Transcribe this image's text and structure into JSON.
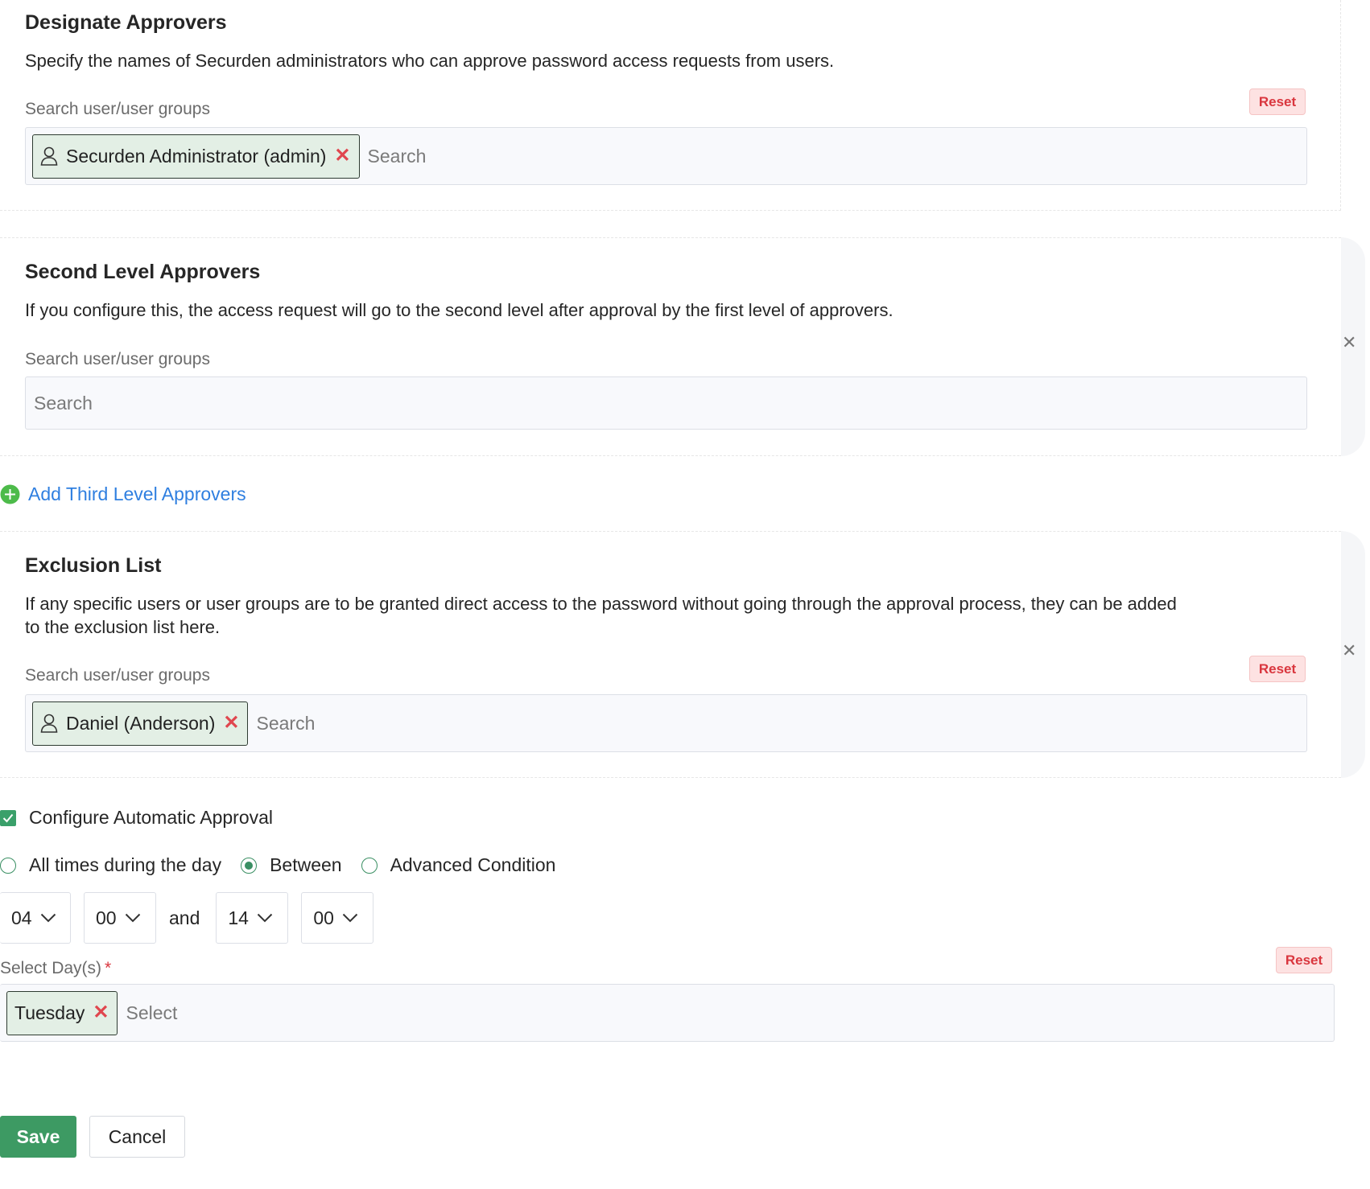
{
  "designate": {
    "title": "Designate Approvers",
    "description": "Specify the names of Securden administrators who can approve password access requests from users.",
    "search_label": "Search user/user groups",
    "reset_label": "Reset",
    "chip_label": "Securden Administrator (admin)",
    "search_placeholder": "Search"
  },
  "second_level": {
    "title": "Second Level Approvers",
    "description": "If you configure this, the access request will go to the second level after approval by the first level of approvers.",
    "search_label": "Search user/user groups",
    "search_placeholder": "Search"
  },
  "add_third_level": {
    "label": "Add Third Level Approvers"
  },
  "exclusion": {
    "title": "Exclusion List",
    "description": "If any specific users or user groups are to be granted direct access to the password without going through the approval process, they can be added to the exclusion list here.",
    "search_label": "Search user/user groups",
    "reset_label": "Reset",
    "chip_label": "Daniel (Anderson)",
    "search_placeholder": "Search"
  },
  "auto_approval": {
    "checkbox_label": "Configure Automatic Approval",
    "checked": true,
    "radio_options": [
      "All times during the day",
      "Between",
      "Advanced Condition"
    ],
    "selected_option": "Between",
    "from_hour": "04",
    "from_minute": "00",
    "and_text": "and",
    "to_hour": "14",
    "to_minute": "00",
    "days_label": "Select Day(s)",
    "required_mark": "*",
    "days_reset_label": "Reset",
    "day_chip": "Tuesday",
    "days_placeholder": "Select"
  },
  "footer": {
    "save_label": "Save",
    "cancel_label": "Cancel"
  },
  "colors": {
    "primary_green": "#3d9a63",
    "link_blue": "#2f7fe0",
    "reset_red": "#d9363e",
    "chip_bg": "#e3efe5"
  }
}
